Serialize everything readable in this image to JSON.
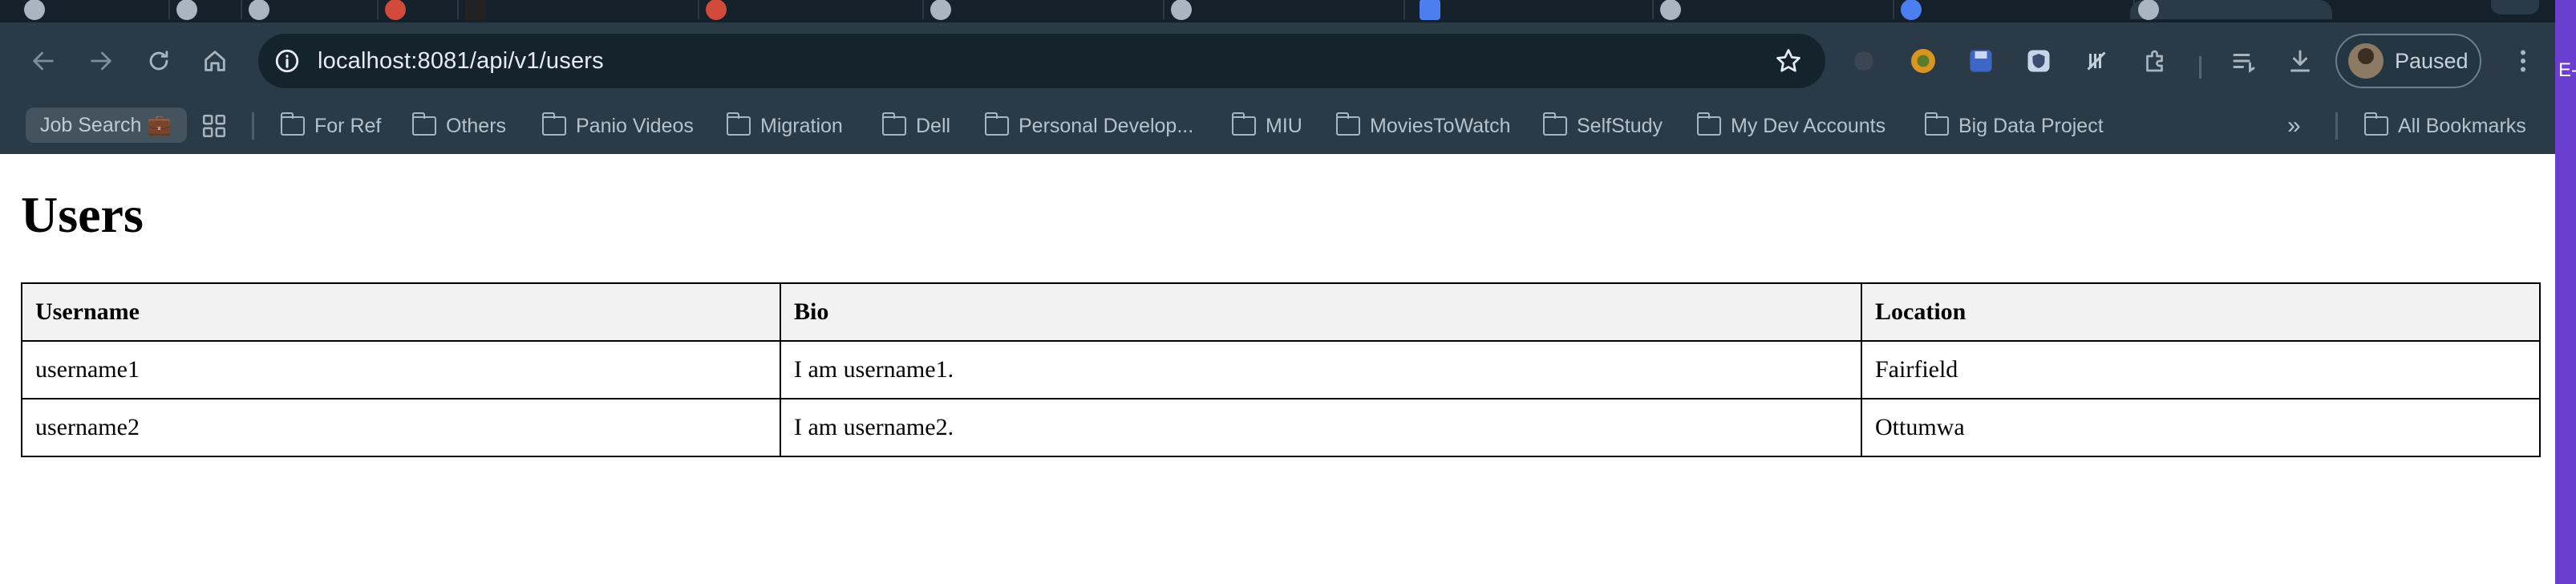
{
  "browser": {
    "url": "localhost:8081/api/v1/users",
    "profile_label": "Paused",
    "bookmarks": {
      "job_search": "Job Search 💼",
      "folders": [
        "For Ref",
        "Others",
        "Panio Videos",
        "Migration",
        "Dell",
        "Personal Develop...",
        "MIU",
        "MoviesToWatch",
        "SelfStudy",
        "My Dev Accounts",
        "Big Data Project"
      ],
      "more": "»",
      "all_bookmarks": "All Bookmarks"
    },
    "edge_text": "E-"
  },
  "page": {
    "title": "Users",
    "table": {
      "headers": [
        "Username",
        "Bio",
        "Location"
      ],
      "rows": [
        [
          "username1",
          "I am username1.",
          "Fairfield"
        ],
        [
          "username2",
          "I am username2.",
          "Ottumwa"
        ]
      ]
    }
  }
}
